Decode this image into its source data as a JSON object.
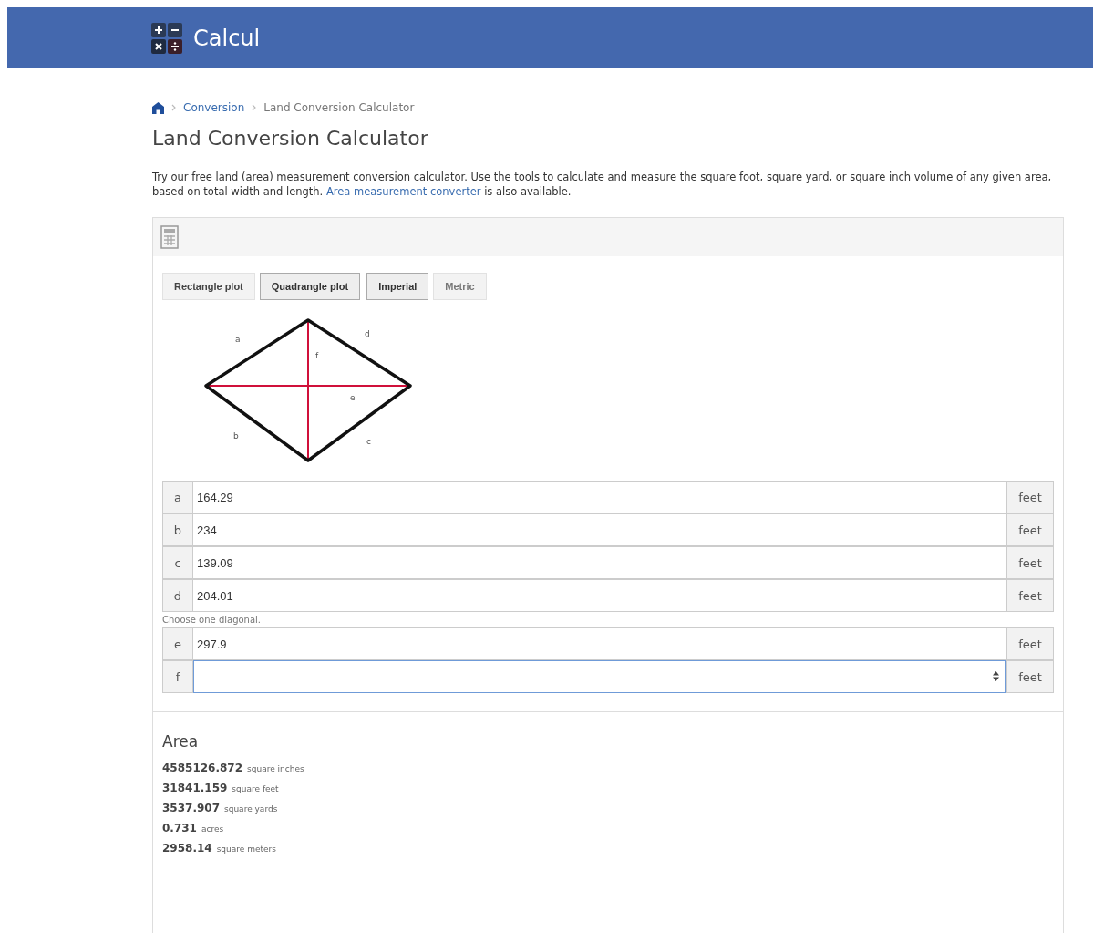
{
  "header": {
    "title": "Calcul"
  },
  "breadcrumb": [
    {
      "label": "Conversion",
      "kind": "link"
    },
    {
      "label": "Land Conversion Calculator",
      "kind": "current"
    }
  ],
  "page_title": "Land Conversion Calculator",
  "intro": {
    "text": "Try our free land (area) measurement conversion calculator. Use the tools to calculate and measure the square foot, square yard, or square inch volume of any given area, based on total width and length.",
    "link": "Area measurement converter",
    "after": "is also available."
  },
  "shape_tabs": [
    {
      "label": "Rectangle plot",
      "selected": false
    },
    {
      "label": "Quadrangle plot",
      "selected": true
    }
  ],
  "unit_tabs": [
    {
      "label": "Imperial",
      "selected": true
    },
    {
      "label": "Metric",
      "selected": false
    }
  ],
  "diagram_labels": [
    "a",
    "d",
    "f",
    "e",
    "b",
    "c"
  ],
  "sides": [
    {
      "label": "a",
      "value": "164.29",
      "unit": "feet",
      "focused": false
    },
    {
      "label": "b",
      "value": "234",
      "unit": "feet",
      "focused": false
    },
    {
      "label": "c",
      "value": "139.09",
      "unit": "feet",
      "focused": false
    },
    {
      "label": "d",
      "value": "204.01",
      "unit": "feet",
      "focused": false
    }
  ],
  "diagonal_hint": "Choose one diagonal.",
  "diagonals": [
    {
      "label": "e",
      "value": "297.9",
      "unit": "feet",
      "focused": false
    },
    {
      "label": "f",
      "unit": "feet",
      "focused": true
    }
  ],
  "result": {
    "title": "Area",
    "rows": [
      {
        "value": "4585126.872",
        "unit": "square inches"
      },
      {
        "value": "31841.159",
        "unit": "square feet"
      },
      {
        "value": "3537.907",
        "unit": "square yards"
      },
      {
        "value": "0.731",
        "unit": "acres"
      },
      {
        "value": "2958.14",
        "unit": "square meters"
      }
    ]
  }
}
